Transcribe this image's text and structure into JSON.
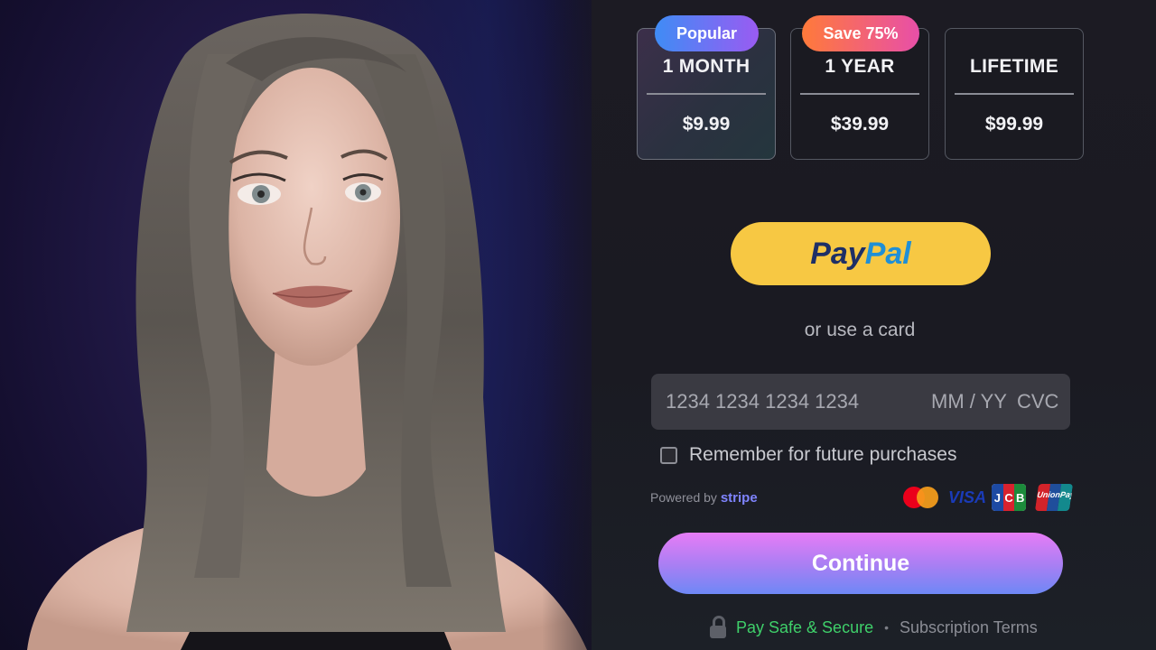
{
  "plans": [
    {
      "name": "1 MONTH",
      "price": "$9.99",
      "badge": "Popular",
      "selected": true
    },
    {
      "name": "1 YEAR",
      "price": "$39.99",
      "badge": "Save 75%",
      "selected": false
    },
    {
      "name": "LIFETIME",
      "price": "$99.99",
      "badge": "",
      "selected": false
    }
  ],
  "paypal": {
    "pay": "Pay",
    "pal": "Pal"
  },
  "or_card": "or use a card",
  "card": {
    "number_placeholder": "1234 1234 1234 1234",
    "exp_placeholder": "MM / YY",
    "cvc_placeholder": "CVC"
  },
  "remember_label": "Remember for future purchases",
  "powered_by": {
    "text": "Powered by",
    "brand": "stripe"
  },
  "card_brands": {
    "visa": "VISA",
    "jcb": [
      "J",
      "C",
      "B"
    ],
    "unionpay": "UnionPay"
  },
  "continue_label": "Continue",
  "footer": {
    "safe": "Pay Safe & Secure",
    "separator": "•",
    "terms": "Subscription Terms"
  },
  "colors": {
    "paypal_yellow": "#f7c843",
    "safe_green": "#3fd06a",
    "continue_gradient": [
      "#e77cf6",
      "#6e88f6"
    ]
  }
}
